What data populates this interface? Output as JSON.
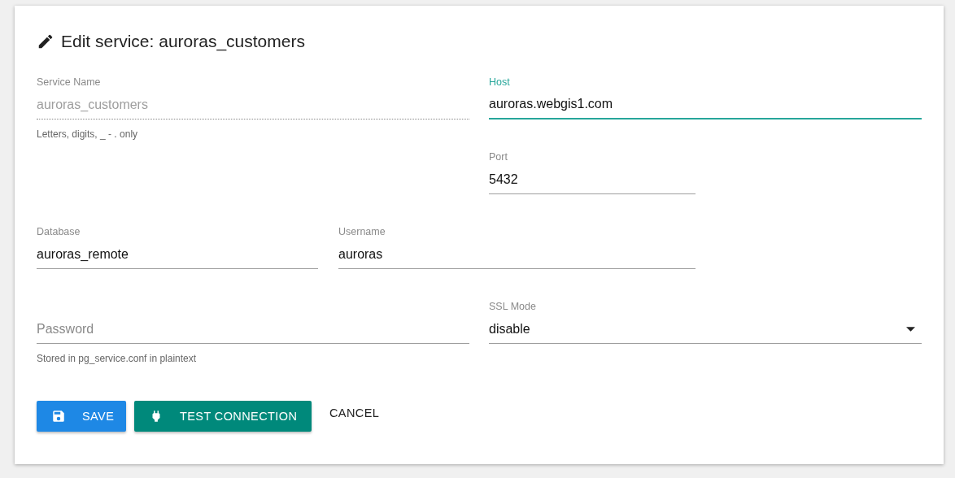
{
  "title": "Edit service: auroras_customers",
  "service_name": {
    "label": "Service Name",
    "value": "auroras_customers",
    "hint": "Letters, digits, _ - . only",
    "disabled": true,
    "focused": false
  },
  "host": {
    "label": "Host",
    "value": "auroras.webgis1.com",
    "disabled": false,
    "focused": true
  },
  "port": {
    "label": "Port",
    "value": "5432",
    "disabled": false,
    "focused": false
  },
  "database": {
    "label": "Database",
    "value": "auroras_remote",
    "disabled": false,
    "focused": false
  },
  "username": {
    "label": "Username",
    "value": "auroras",
    "disabled": false,
    "focused": false
  },
  "password": {
    "placeholder": "Password",
    "hint": "Stored in pg_service.conf in plaintext",
    "disabled": false,
    "focused": false
  },
  "ssl_mode": {
    "label": "SSL Mode",
    "value": "disable",
    "disabled": false,
    "focused": false
  },
  "buttons": [
    {
      "label": "SAVE",
      "kind": "save"
    },
    {
      "label": "TEST CONNECTION",
      "kind": "test"
    },
    {
      "label": "CANCEL",
      "kind": "flat"
    }
  ]
}
